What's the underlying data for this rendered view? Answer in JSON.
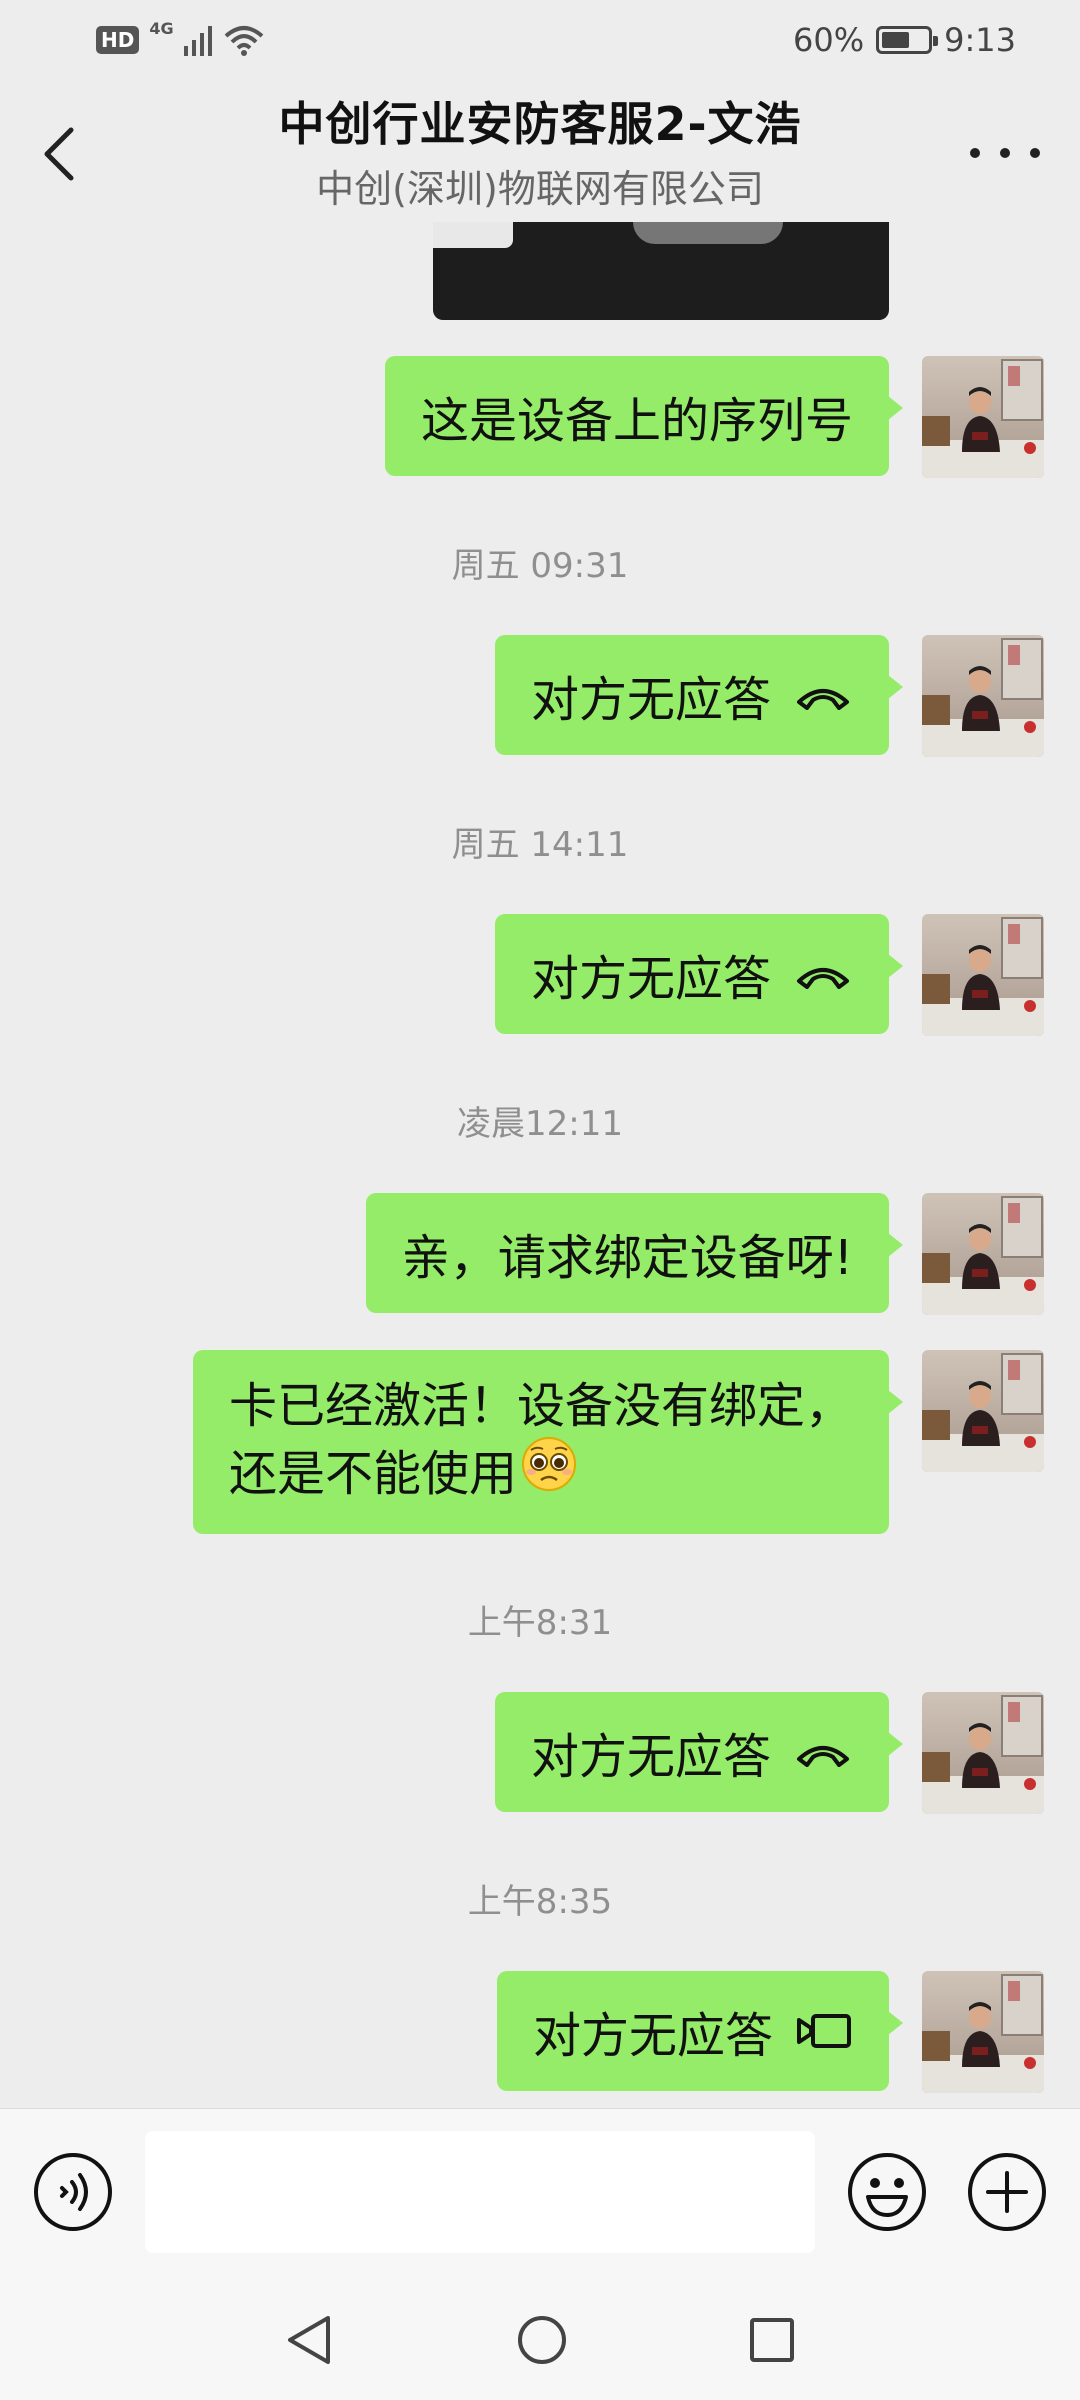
{
  "status_bar": {
    "hd_badge": "HD",
    "network": "4G",
    "battery_text": "60%",
    "battery_level": 0.6,
    "time": "9:13"
  },
  "header": {
    "title": "中创行业安防客服2-文浩",
    "subtitle": "中创(深圳)物联网有限公司",
    "back_icon": "chevron-left-icon",
    "more_icon": "more-dots-icon"
  },
  "messages": [
    {
      "type": "text",
      "text": "这是设备上的序列号"
    },
    {
      "type": "timestamp",
      "text": "周五 09:31"
    },
    {
      "type": "call",
      "text": "对方无应答",
      "icon": "phone-hangup-icon"
    },
    {
      "type": "timestamp",
      "text": "周五 14:11"
    },
    {
      "type": "call",
      "text": "对方无应答",
      "icon": "phone-hangup-icon"
    },
    {
      "type": "timestamp",
      "text": "凌晨12:11"
    },
    {
      "type": "text",
      "text": "亲，请求绑定设备呀!"
    },
    {
      "type": "text",
      "line1": "卡已经激活！设备没有绑定，",
      "line2": "还是不能使用",
      "emoji": "pleading-face-emoji"
    },
    {
      "type": "timestamp",
      "text": "上午8:31"
    },
    {
      "type": "call",
      "text": "对方无应答",
      "icon": "phone-hangup-icon"
    },
    {
      "type": "timestamp",
      "text": "上午8:35"
    },
    {
      "type": "call",
      "text": "对方无应答",
      "icon": "video-call-icon"
    }
  ],
  "input_bar": {
    "text_value": "",
    "voice_icon": "voice-icon",
    "emoji_icon": "emoji-icon",
    "plus_icon": "plus-icon"
  },
  "colors": {
    "bubble": "#95ec69",
    "background": "#ededed"
  }
}
